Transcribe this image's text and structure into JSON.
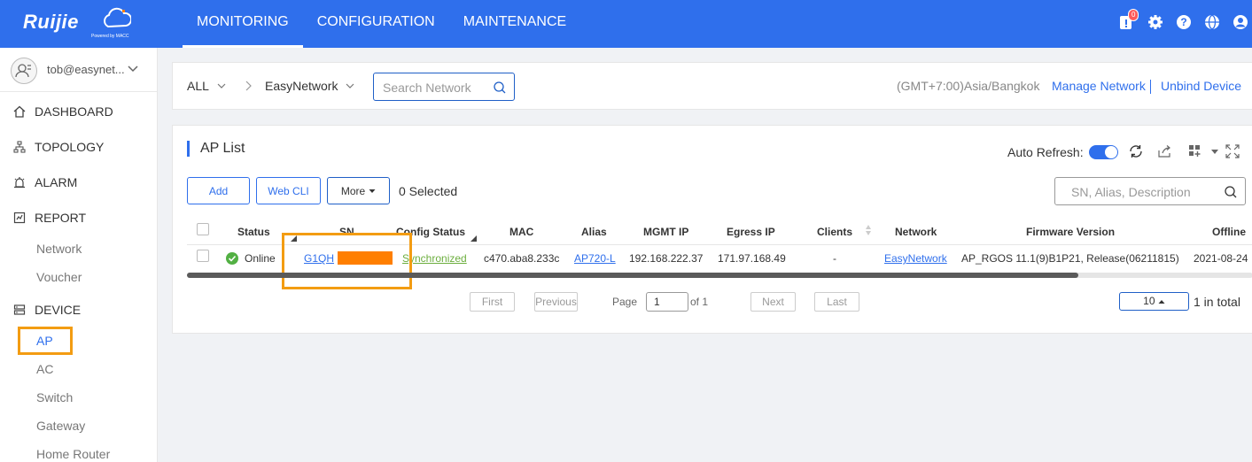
{
  "brand": {
    "logo_text": "Ruijie",
    "logo_sub": "Powered by MACC"
  },
  "topnav": {
    "tabs": [
      "MONITORING",
      "CONFIGURATION",
      "MAINTENANCE"
    ],
    "active": "MONITORING"
  },
  "top_icons": {
    "notification_count": "0"
  },
  "sidebar": {
    "user": "tob@easynet...",
    "menu": {
      "dashboard": "DASHBOARD",
      "topology": "TOPOLOGY",
      "alarm": "ALARM",
      "report": "REPORT",
      "report_network": "Network",
      "report_voucher": "Voucher",
      "device": "DEVICE",
      "device_ap": "AP",
      "device_ac": "AC",
      "device_switch": "Switch",
      "device_gateway": "Gateway",
      "device_home_router": "Home Router"
    }
  },
  "filter": {
    "scope": "ALL",
    "network": "EasyNetwork",
    "search_placeholder": "Search Network",
    "timezone": "(GMT+7:00)Asia/Bangkok",
    "manage_network": "Manage Network",
    "unbind_device": "Unbind Device"
  },
  "ap_list": {
    "title": "AP List",
    "auto_refresh_label": "Auto Refresh:",
    "auto_refresh_on": true,
    "buttons": {
      "add": "Add",
      "web_cli": "Web CLI",
      "more": "More"
    },
    "selected_text": "0 Selected",
    "search_placeholder": "SN, Alias, Description",
    "columns": {
      "status": "Status",
      "sn": "SN",
      "config_status": "Config Status",
      "mac": "MAC",
      "alias": "Alias",
      "mgmt_ip": "MGMT IP",
      "egress_ip": "Egress IP",
      "clients": "Clients",
      "network": "Network",
      "firmware": "Firmware Version",
      "offline": "Offline"
    },
    "rows": [
      {
        "status": "Online",
        "sn": "G1QH",
        "config_status": "Synchronized",
        "mac": "c470.aba8.233c",
        "alias": "AP720-L",
        "mgmt_ip": "192.168.222.37",
        "egress_ip": "171.97.168.49",
        "clients": "-",
        "network": "EasyNetwork",
        "firmware": "AP_RGOS 11.1(9)B1P21, Release(06211815)",
        "offline": "2021-08-24"
      }
    ],
    "pagination": {
      "first": "First",
      "previous": "Previous",
      "page_label": "Page",
      "page_value": "1",
      "of_label": "of 1",
      "next": "Next",
      "last": "Last",
      "page_size": "10",
      "total": "1 in total"
    }
  },
  "colors": {
    "brand_blue": "#2f6fec",
    "highlight_orange": "#f39c12",
    "online_green": "#52b043"
  }
}
